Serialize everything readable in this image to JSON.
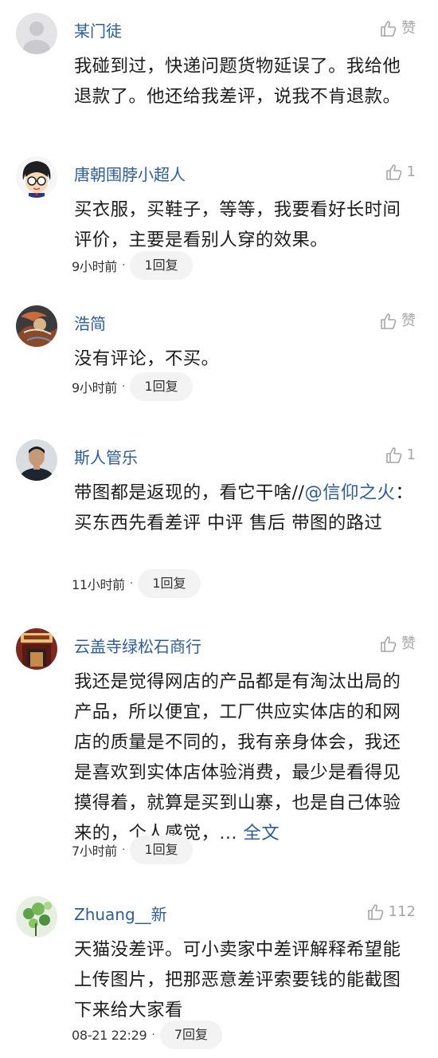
{
  "comments": [
    {
      "username": "某门徒",
      "like_label": "赞",
      "text": "我碰到过，快递问题货物延误了。我给他退款了。他还给我差评，说我不肯退款。",
      "time": "",
      "reply_label": ""
    },
    {
      "username": "唐朝围脖小超人",
      "like_label": "1",
      "text": "买衣服，买鞋子，等等，我要看好长时间评价，主要是看别人穿的效果。",
      "time": "9小时前",
      "reply_label": "1回复"
    },
    {
      "username": "浩简",
      "like_label": "赞",
      "text": "没有评论，不买。",
      "time": "9小时前",
      "reply_label": "1回复"
    },
    {
      "username": "斯人管乐",
      "like_label": "1",
      "text_before": "带图都是返现的，看它干啥//",
      "mention": "@信仰之火",
      "text_after": "：买东西先看差评 中评 售后  带图的路过",
      "time": "11小时前",
      "reply_label": "1回复"
    },
    {
      "username": "云盖寺绿松石商行",
      "like_label": "赞",
      "text": "我还是觉得网店的产品都是有淘汰出局的产品，所以便宜，工厂供应实体店的和网店的质量是不同的，我有亲身体会，我还是喜欢到实体店体验消费，最少是看得见摸得着，就算是买到山寨，也是自己体验来的，个人感觉，",
      "ellipsis": "...",
      "full_text_label": "全文",
      "time": "7小时前",
      "reply_label": "1回复"
    },
    {
      "username": "Zhuang__新",
      "like_label": "112",
      "text": "天猫没差评。可小卖家中差评解释希望能上传图片，把那恶意差评索要钱的能截图下来给大家看",
      "time": "08-21 22:29",
      "reply_label": "7回复"
    }
  ],
  "meta_separator": "·",
  "icons": {
    "like": "thumbs-up-icon"
  },
  "colors": {
    "username": "#2f5d94",
    "link": "#2f5d94",
    "muted": "#a6a6a6",
    "pill_bg": "#f3f3f3"
  }
}
